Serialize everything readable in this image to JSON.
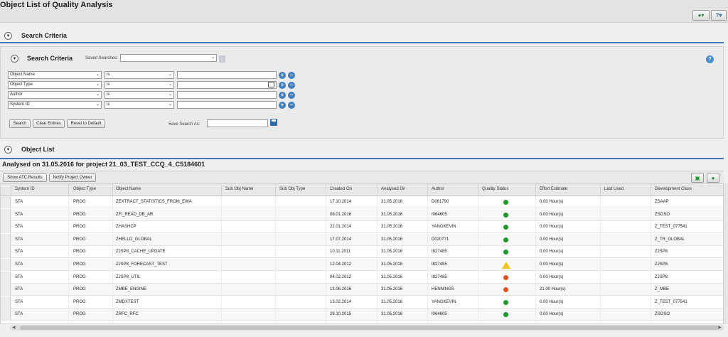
{
  "page": {
    "title": "Object List of Quality Analysis"
  },
  "toolbar_top": {
    "personalize_icon": "person-settings-icon",
    "help_icon": "help-icon"
  },
  "sections": {
    "search_criteria": "Search Criteria",
    "object_list": "Object List"
  },
  "criteria": {
    "title": "Search Criteria",
    "saved_searches_label": "Saved Searches:",
    "saved_searches_value": "",
    "rows": [
      {
        "field": "Object Name",
        "operator": "is",
        "value": ""
      },
      {
        "field": "Object Type",
        "operator": "is",
        "value": ""
      },
      {
        "field": "Author",
        "operator": "is",
        "value": ""
      },
      {
        "field": "System ID",
        "operator": "is",
        "value": ""
      }
    ],
    "buttons": {
      "search": "Search",
      "clear": "Clear Entries",
      "reset": "Reset to Default"
    },
    "save_search_as_label": "Save Search As:",
    "save_search_as_value": ""
  },
  "result": {
    "heading": "Analysed on 31.05.2016 for project 21_03_TEST_CCQ_4_C5184601",
    "buttons": {
      "show_atc": "Show ATC Results",
      "notify_owner": "Notify Project Owner"
    },
    "columns": [
      "System ID",
      "Object Type",
      "Object Name",
      "Sub Obj Name",
      "Sub Obj Type",
      "Created On",
      "Analysed On",
      "Author",
      "Quality Status",
      "Effort Estimate",
      "Last Used",
      "Development Class"
    ],
    "rows": [
      {
        "system_id": "STA",
        "object_type": "PROG",
        "object_name": "ZEXTRACT_STATISTICS_FROM_EWA",
        "sub_obj_name": "",
        "sub_obj_type": "",
        "created_on": "17.10.2014",
        "analysed_on": "31.05.2016",
        "author": "D061790",
        "status": "green",
        "effort": "0.00 Hour(s)",
        "last_used": "",
        "dev_class": "ZSAAP"
      },
      {
        "system_id": "STA",
        "object_type": "PROG",
        "object_name": "ZFI_READ_DB_AR",
        "sub_obj_name": "",
        "sub_obj_type": "",
        "created_on": "08.01.2016",
        "analysed_on": "31.05.2016",
        "author": "I064605",
        "status": "green",
        "effort": "0.00 Hour(s)",
        "last_used": "",
        "dev_class": "ZSOSO"
      },
      {
        "system_id": "STA",
        "object_type": "PROG",
        "object_name": "ZHASHCP",
        "sub_obj_name": "",
        "sub_obj_type": "",
        "created_on": "22.01.2014",
        "analysed_on": "31.05.2016",
        "author": "YANGKEVIN",
        "status": "green",
        "effort": "0.00 Hour(s)",
        "last_used": "",
        "dev_class": "Z_TEST_077541"
      },
      {
        "system_id": "STA",
        "object_type": "PROG",
        "object_name": "ZHELLO_GLOBAL",
        "sub_obj_name": "",
        "sub_obj_type": "",
        "created_on": "17.07.2014",
        "analysed_on": "31.05.2016",
        "author": "D020771",
        "status": "green",
        "effort": "0.00 Hour(s)",
        "last_used": "",
        "dev_class": "Z_TR_GLOBAL"
      },
      {
        "system_id": "STA",
        "object_type": "PROG",
        "object_name": "ZJSP8_CACHE_UPDATE",
        "sub_obj_name": "",
        "sub_obj_type": "",
        "created_on": "10.11.2011",
        "analysed_on": "31.05.2016",
        "author": "I827485",
        "status": "green",
        "effort": "0.00 Hour(s)",
        "last_used": "",
        "dev_class": "ZJSP8"
      },
      {
        "system_id": "STA",
        "object_type": "PROG",
        "object_name": "ZJSP8_FORECAST_TEST",
        "sub_obj_name": "",
        "sub_obj_type": "",
        "created_on": "12.04.2012",
        "analysed_on": "31.05.2016",
        "author": "I827485",
        "status": "yellow",
        "effort": "0.00 Hour(s)",
        "last_used": "",
        "dev_class": "ZJSP8"
      },
      {
        "system_id": "STA",
        "object_type": "PROG",
        "object_name": "ZJSP8_UTIL",
        "sub_obj_name": "",
        "sub_obj_type": "",
        "created_on": "04.02.2012",
        "analysed_on": "31.05.2016",
        "author": "I827485",
        "status": "red",
        "effort": "0.00 Hour(s)",
        "last_used": "",
        "dev_class": "ZJSP8"
      },
      {
        "system_id": "STA",
        "object_type": "PROG",
        "object_name": "ZMBE_ENGINE",
        "sub_obj_name": "",
        "sub_obj_type": "",
        "created_on": "13.06.2016",
        "analysed_on": "31.05.2016",
        "author": "HENNINGS",
        "status": "red",
        "effort": "21.00 Hour(s)",
        "last_used": "",
        "dev_class": "Z_MBE"
      },
      {
        "system_id": "STA",
        "object_type": "PROG",
        "object_name": "ZMDXTEST",
        "sub_obj_name": "",
        "sub_obj_type": "",
        "created_on": "13.02.2014",
        "analysed_on": "31.05.2016",
        "author": "YANGKEVIN",
        "status": "green",
        "effort": "0.00 Hour(s)",
        "last_used": "",
        "dev_class": "Z_TEST_077541"
      },
      {
        "system_id": "STA",
        "object_type": "PROG",
        "object_name": "ZRFC_RFC",
        "sub_obj_name": "",
        "sub_obj_type": "",
        "created_on": "29.10.2015",
        "analysed_on": "31.05.2016",
        "author": "I064605",
        "status": "green",
        "effort": "0.00 Hour(s)",
        "last_used": "",
        "dev_class": "ZSOSO"
      }
    ]
  },
  "colors": {
    "accent": "#3a7ab8",
    "green": "#1e9a2c",
    "yellow": "#f2c417",
    "red": "#e0531d"
  }
}
